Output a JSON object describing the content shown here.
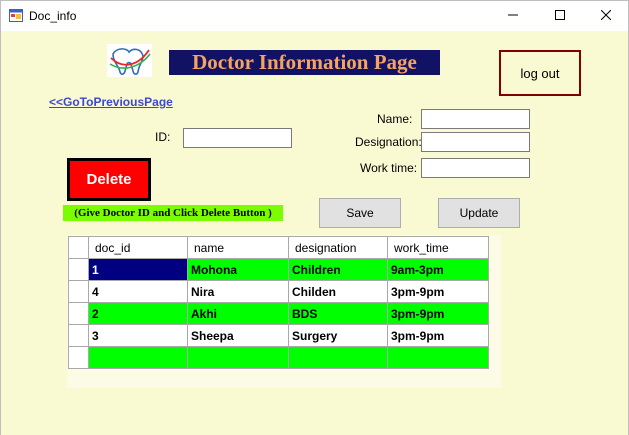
{
  "window": {
    "title": "Doc_info"
  },
  "header": {
    "title": "Doctor Information Page",
    "logout_label": "log out"
  },
  "nav": {
    "back_link": "<<GoToPreviousPage"
  },
  "form": {
    "id_label": "ID:",
    "id_value": "",
    "name_label": "Name:",
    "name_value": "",
    "designation_label": "Designation:",
    "designation_value": "",
    "worktime_label": "Work time:",
    "worktime_value": ""
  },
  "actions": {
    "delete_label": "Delete",
    "delete_hint": "(Give Doctor ID and Click Delete Button )",
    "save_label": "Save",
    "update_label": "Update"
  },
  "grid": {
    "columns": [
      "doc_id",
      "name",
      "designation",
      "work_time"
    ],
    "rows": [
      [
        "1",
        "Mohona",
        "Children",
        "9am-3pm"
      ],
      [
        "4",
        "Nira",
        "Childen",
        "3pm-9pm"
      ],
      [
        "2",
        "Akhi",
        "BDS",
        "3pm-9pm"
      ],
      [
        "3",
        "Sheepa",
        "Surgery",
        "3pm-9pm"
      ],
      [
        "",
        "",
        "",
        ""
      ]
    ],
    "selected_cell": "row 1, doc_id"
  },
  "colors": {
    "background": "#fafad2",
    "title_bg": "#121264",
    "title_text": "#f4a460",
    "delete_bg": "#ff0000",
    "hint_bg": "#7cfc00",
    "row_green": "#00ff00",
    "selected": "#000080",
    "logout_border": "#800000"
  },
  "icons": {
    "app": "form-icon",
    "logo": "tooth-logo-icon",
    "minimize": "minimize-icon",
    "maximize": "maximize-icon",
    "close": "close-icon"
  }
}
